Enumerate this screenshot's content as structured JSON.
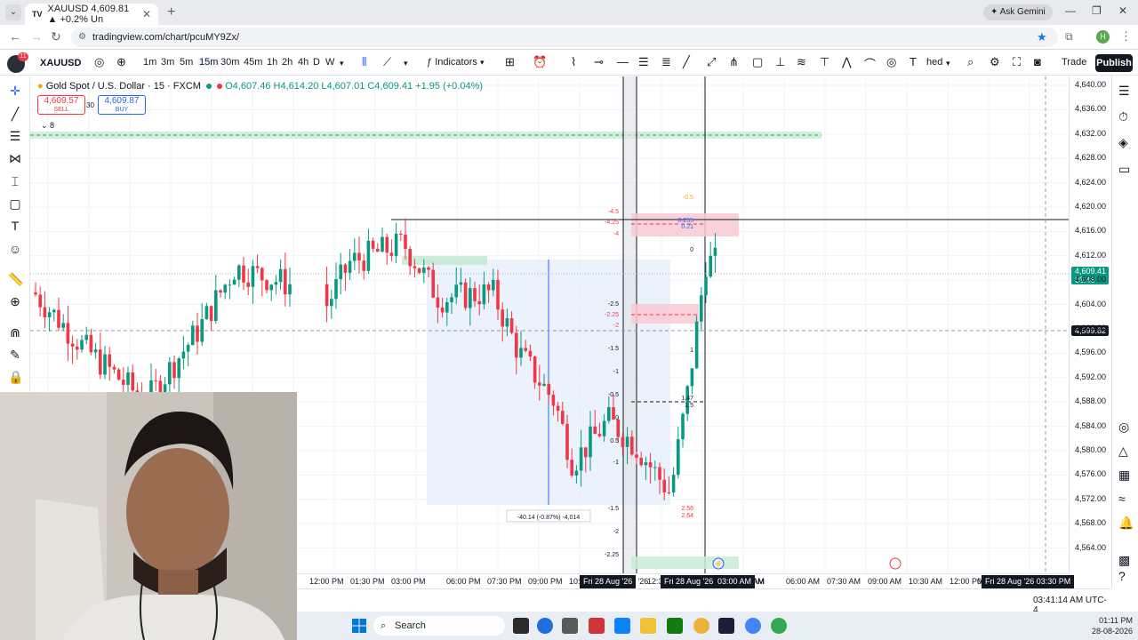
{
  "browser": {
    "tab_title": "XAUUSD 4,609.81 ▲ +0.2% Un",
    "url": "tradingview.com/chart/pcuMY9Zx/",
    "ask_gemini": "Ask Gemini",
    "profile_initial": "H"
  },
  "toolbar": {
    "symbol": "XAUUSD",
    "notification_count": "11",
    "timeframes": [
      "1m",
      "3m",
      "5m",
      "15m",
      "30m",
      "45m",
      "1h",
      "2h",
      "4h",
      "D",
      "W"
    ],
    "active_timeframe": "15m",
    "indicators_label": "Indicators",
    "truncated_label": "hed",
    "trade_label": "Trade",
    "publish_label": "Publish"
  },
  "legend": {
    "title": "Gold Spot / U.S. Dollar · 15 · FXCM",
    "ohlc": "O4,607.46 H4,614.20 L4,607.01 C4,609.41 +1.95 (+0.04%)",
    "sell_price": "4,609.57",
    "sell_label": "SELL",
    "spread": "30",
    "buy_price": "4,609.87",
    "buy_label": "BUY",
    "collapse_count": "8"
  },
  "price_axis": {
    "labels": [
      "4,640.00",
      "4,636.00",
      "4,632.00",
      "4,628.00",
      "4,624.00",
      "4,620.00",
      "4,616.00",
      "4,612.00",
      "4,608.00",
      "4,604.00",
      "4,600.00",
      "4,596.00",
      "4,592.00",
      "4,588.00",
      "4,584.00",
      "4,580.00",
      "4,576.00",
      "4,572.00",
      "4,568.00",
      "4,564.00"
    ],
    "current_price": "4,609.41",
    "countdown": "03:46",
    "crosshair_price": "4,599.82"
  },
  "time_axis": {
    "labels": [
      "12:00 PM",
      "01:30 PM",
      "03:00 PM",
      "06:00 PM",
      "07:30 PM",
      "09:00 PM",
      "10:",
      "Fri 28 Aug '26",
      "12:3",
      "Fri 28 Aug '26",
      "03:00 AM",
      "AM",
      "06:00 AM",
      "07:30 AM",
      "09:00 AM",
      "10:30 AM",
      "12:00 PM",
      "0",
      "Fri 28 Aug '26",
      "03:30 PM"
    ],
    "highlight_1": "Fri 28 Aug '26",
    "highlight_2": "Fri 28 Aug '26",
    "highlight_3": "03:00 AM",
    "highlight_4": "Fri 28 Aug '26  03:30 PM"
  },
  "annotations": {
    "measure_label": "-40.14 (-0.87%) -4,014",
    "fib_left": [
      "-4.5",
      "-4.25",
      "-4",
      "-2.5",
      "-2.25",
      "-2",
      "-1.5",
      "-1",
      "-0.5",
      "0",
      "0.5",
      "-1",
      "-1.5",
      "-2",
      "-2.25"
    ],
    "fib_right": [
      "-0.5",
      "0.255",
      "0.21",
      "0",
      "1",
      "1.47",
      "1.5",
      "2.56",
      "2.64"
    ]
  },
  "clock": "03:41:14 AM UTC-4",
  "taskbar": {
    "search_placeholder": "Search",
    "time": "01:11 PM",
    "date": "28-08-2026"
  },
  "chart_data": {
    "type": "candlestick",
    "title": "Gold Spot / U.S. Dollar · 15 · FXCM",
    "ylim": [
      4562,
      4641
    ],
    "colors": {
      "up": "#089981",
      "down": "#f23645"
    }
  }
}
